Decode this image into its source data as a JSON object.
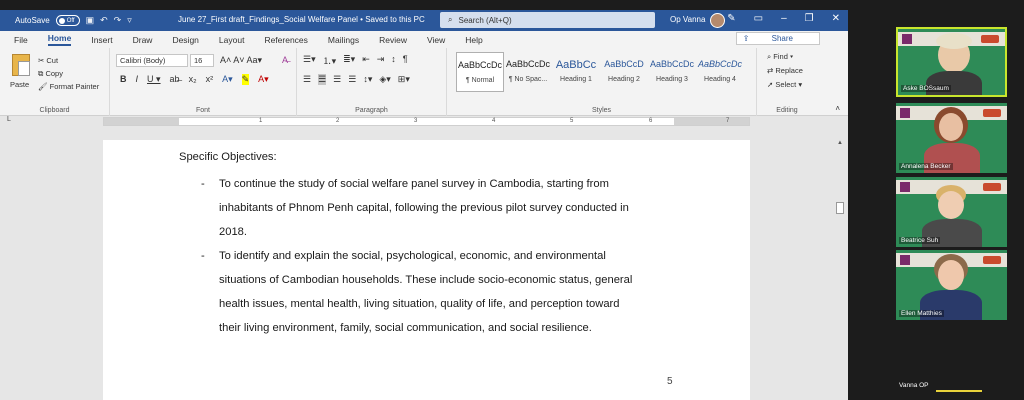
{
  "titlebar": {
    "autosave_label": "AutoSave",
    "autosave_state": "Off",
    "doc_title": "June 27_First draft_Findings_Social Welfare Panel  •  Saved to this PC",
    "search_placeholder": "Search (Alt+Q)",
    "user_name": "Op Vanna"
  },
  "menu": {
    "items": [
      "File",
      "Home",
      "Insert",
      "Draw",
      "Design",
      "Layout",
      "References",
      "Mailings",
      "Review",
      "View",
      "Help"
    ],
    "share": "Share"
  },
  "ribbon": {
    "clipboard": {
      "paste": "Paste",
      "cut": "Cut",
      "copy": "Copy",
      "format_painter": "Format Painter",
      "label": "Clipboard"
    },
    "font": {
      "name": "Calibri (Body)",
      "size": "16",
      "label": "Font"
    },
    "paragraph": {
      "label": "Paragraph"
    },
    "styles": {
      "label": "Styles",
      "items": [
        {
          "preview": "AaBbCcDc",
          "name": "¶ Normal"
        },
        {
          "preview": "AaBbCcDc",
          "name": "¶ No Spac..."
        },
        {
          "preview": "AaBbCc",
          "name": "Heading 1"
        },
        {
          "preview": "AaBbCcD",
          "name": "Heading 2"
        },
        {
          "preview": "AaBbCcDc",
          "name": "Heading 3"
        },
        {
          "preview": "AaBbCcDc",
          "name": "Heading 4"
        }
      ]
    },
    "editing": {
      "find": "Find",
      "replace": "Replace",
      "select": "Select",
      "label": "Editing"
    }
  },
  "ruler": {
    "marks": [
      "1",
      "2",
      "3",
      "4",
      "5",
      "6",
      "7"
    ]
  },
  "document": {
    "heading": "Specific Objectives:",
    "bullets": [
      {
        "dash": "-",
        "lines": [
          "To continue the study of social welfare panel survey in Cambodia, starting from",
          "inhabitants of Phnom Penh capital, following the previous pilot survey conducted in",
          "2018."
        ]
      },
      {
        "dash": "-",
        "lines": [
          "To identify and explain the social, psychological, economic, and environmental",
          "situations of Cambodian households. These include socio-economic status, general",
          "health issues, mental health, living situation, quality of life, and perception toward",
          "their living environment, family, social communication, and social resilience."
        ]
      }
    ],
    "page_number": "5"
  },
  "participants": [
    {
      "name": "Aske BOSsaum",
      "active": true
    },
    {
      "name": "Annalena Becker",
      "active": false
    },
    {
      "name": "Beatrice Suh",
      "active": false
    },
    {
      "name": "Ellen Matthies",
      "active": false
    },
    {
      "name": "Vanna OP",
      "active": false
    }
  ],
  "colors": {
    "word_blue": "#2b579a",
    "tile_green": "#2e8b57",
    "active_border": "#c8e62d"
  }
}
